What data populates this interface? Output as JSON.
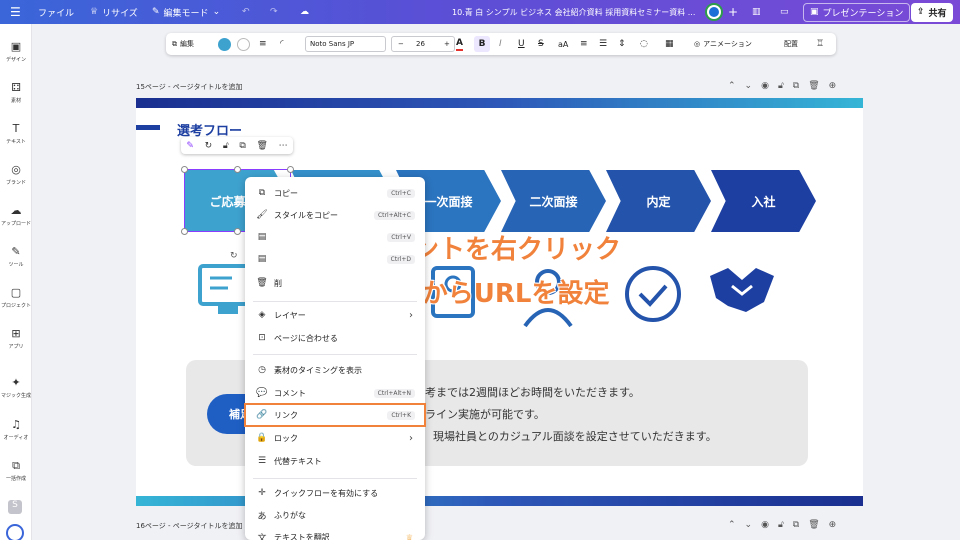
{
  "topbar": {
    "menu_icon": "hamburger-icon",
    "file": "ファイル",
    "resize": "リサイズ",
    "edit_mode": "編集モード",
    "doc_title": "10.青 白 シンプル ビジネス 会社紹介資料 採用資料セミナー資料 ...",
    "present": "プレゼンテーション",
    "share": "共有"
  },
  "rail": [
    {
      "icon": "▣",
      "label": "デザイン"
    },
    {
      "icon": "⚃",
      "label": "素材"
    },
    {
      "icon": "T",
      "label": "テキスト"
    },
    {
      "icon": "◎",
      "label": "ブランド"
    },
    {
      "icon": "☁",
      "label": "アップロード"
    },
    {
      "icon": "✎",
      "label": "ツール"
    },
    {
      "icon": "▢",
      "label": "プロジェクト"
    },
    {
      "icon": "⊞",
      "label": "アプリ"
    },
    {
      "icon": "✦",
      "label": "マジック生成"
    },
    {
      "icon": "♫",
      "label": "オーディオ"
    },
    {
      "icon": "⧉",
      "label": "一括作成"
    }
  ],
  "text_toolbar": {
    "edit": "編集",
    "font": "Noto Sans JP",
    "minus": "−",
    "size": "26",
    "plus": "+",
    "text_color": "A",
    "bold": "B",
    "italic": "I",
    "underline": "U",
    "strike": "S",
    "case": "aA",
    "animation": "アニメーション",
    "arrange": "配置"
  },
  "pages": {
    "page15": "15ページ - ページタイトルを追加",
    "page16": "16ページ - ページタイトルを追加"
  },
  "slide": {
    "title": "選考フロー",
    "steps": [
      {
        "label": "ご応募",
        "color": "#3ea2cf"
      },
      {
        "label": "",
        "color": "#3590cb"
      },
      {
        "label": "一次面接",
        "color": "#2b74bf"
      },
      {
        "label": "二次面接",
        "color": "#2764b5"
      },
      {
        "label": "内定",
        "color": "#2353ab"
      },
      {
        "label": "入社",
        "color": "#1d3fa1"
      }
    ],
    "note_button": "補足",
    "note_lines": [
      "考までは2週間ほどお時間をいただきます。",
      "ライン実施が可能です。",
      "現場社員とのカジュアル面談を設定させていただきます。"
    ]
  },
  "overlay": {
    "line1": "図形やエレメントを右クリック",
    "line2": "→「リンク」からURLを設定",
    "color": "#f0823c"
  },
  "context_menu": {
    "items": [
      {
        "icon": "⧉",
        "label": "コピー",
        "shortcut": "Ctrl+C"
      },
      {
        "icon": "🖌",
        "label": "スタイルをコピー",
        "shortcut": "Ctrl+Alt+C"
      },
      {
        "icon": "▤",
        "label": "",
        "shortcut": "Ctrl+V"
      },
      {
        "icon": "▤",
        "label": "",
        "shortcut": "Ctrl+D"
      },
      {
        "icon": "🗑",
        "label": "削",
        "shortcut": ""
      },
      {
        "icon": "◈",
        "label": "レイヤー",
        "shortcut": "",
        "arrow": "›"
      },
      {
        "icon": "⊡",
        "label": "ページに合わせる",
        "shortcut": ""
      },
      {
        "icon": "◷",
        "label": "素材のタイミングを表示",
        "shortcut": ""
      },
      {
        "icon": "💬",
        "label": "コメント",
        "shortcut": "Ctrl+Alt+N"
      },
      {
        "icon": "🔗",
        "label": "リンク",
        "shortcut": "Ctrl+K"
      },
      {
        "icon": "🔒",
        "label": "ロック",
        "shortcut": "",
        "arrow": "›"
      },
      {
        "icon": "☰",
        "label": "代替テキスト",
        "shortcut": ""
      },
      {
        "icon": "✛",
        "label": "クイックフローを有効にする",
        "shortcut": ""
      },
      {
        "icon": "あ",
        "label": "ふりがな",
        "shortcut": ""
      },
      {
        "icon": "文",
        "label": "テキストを翻訳",
        "shortcut": ""
      }
    ]
  }
}
